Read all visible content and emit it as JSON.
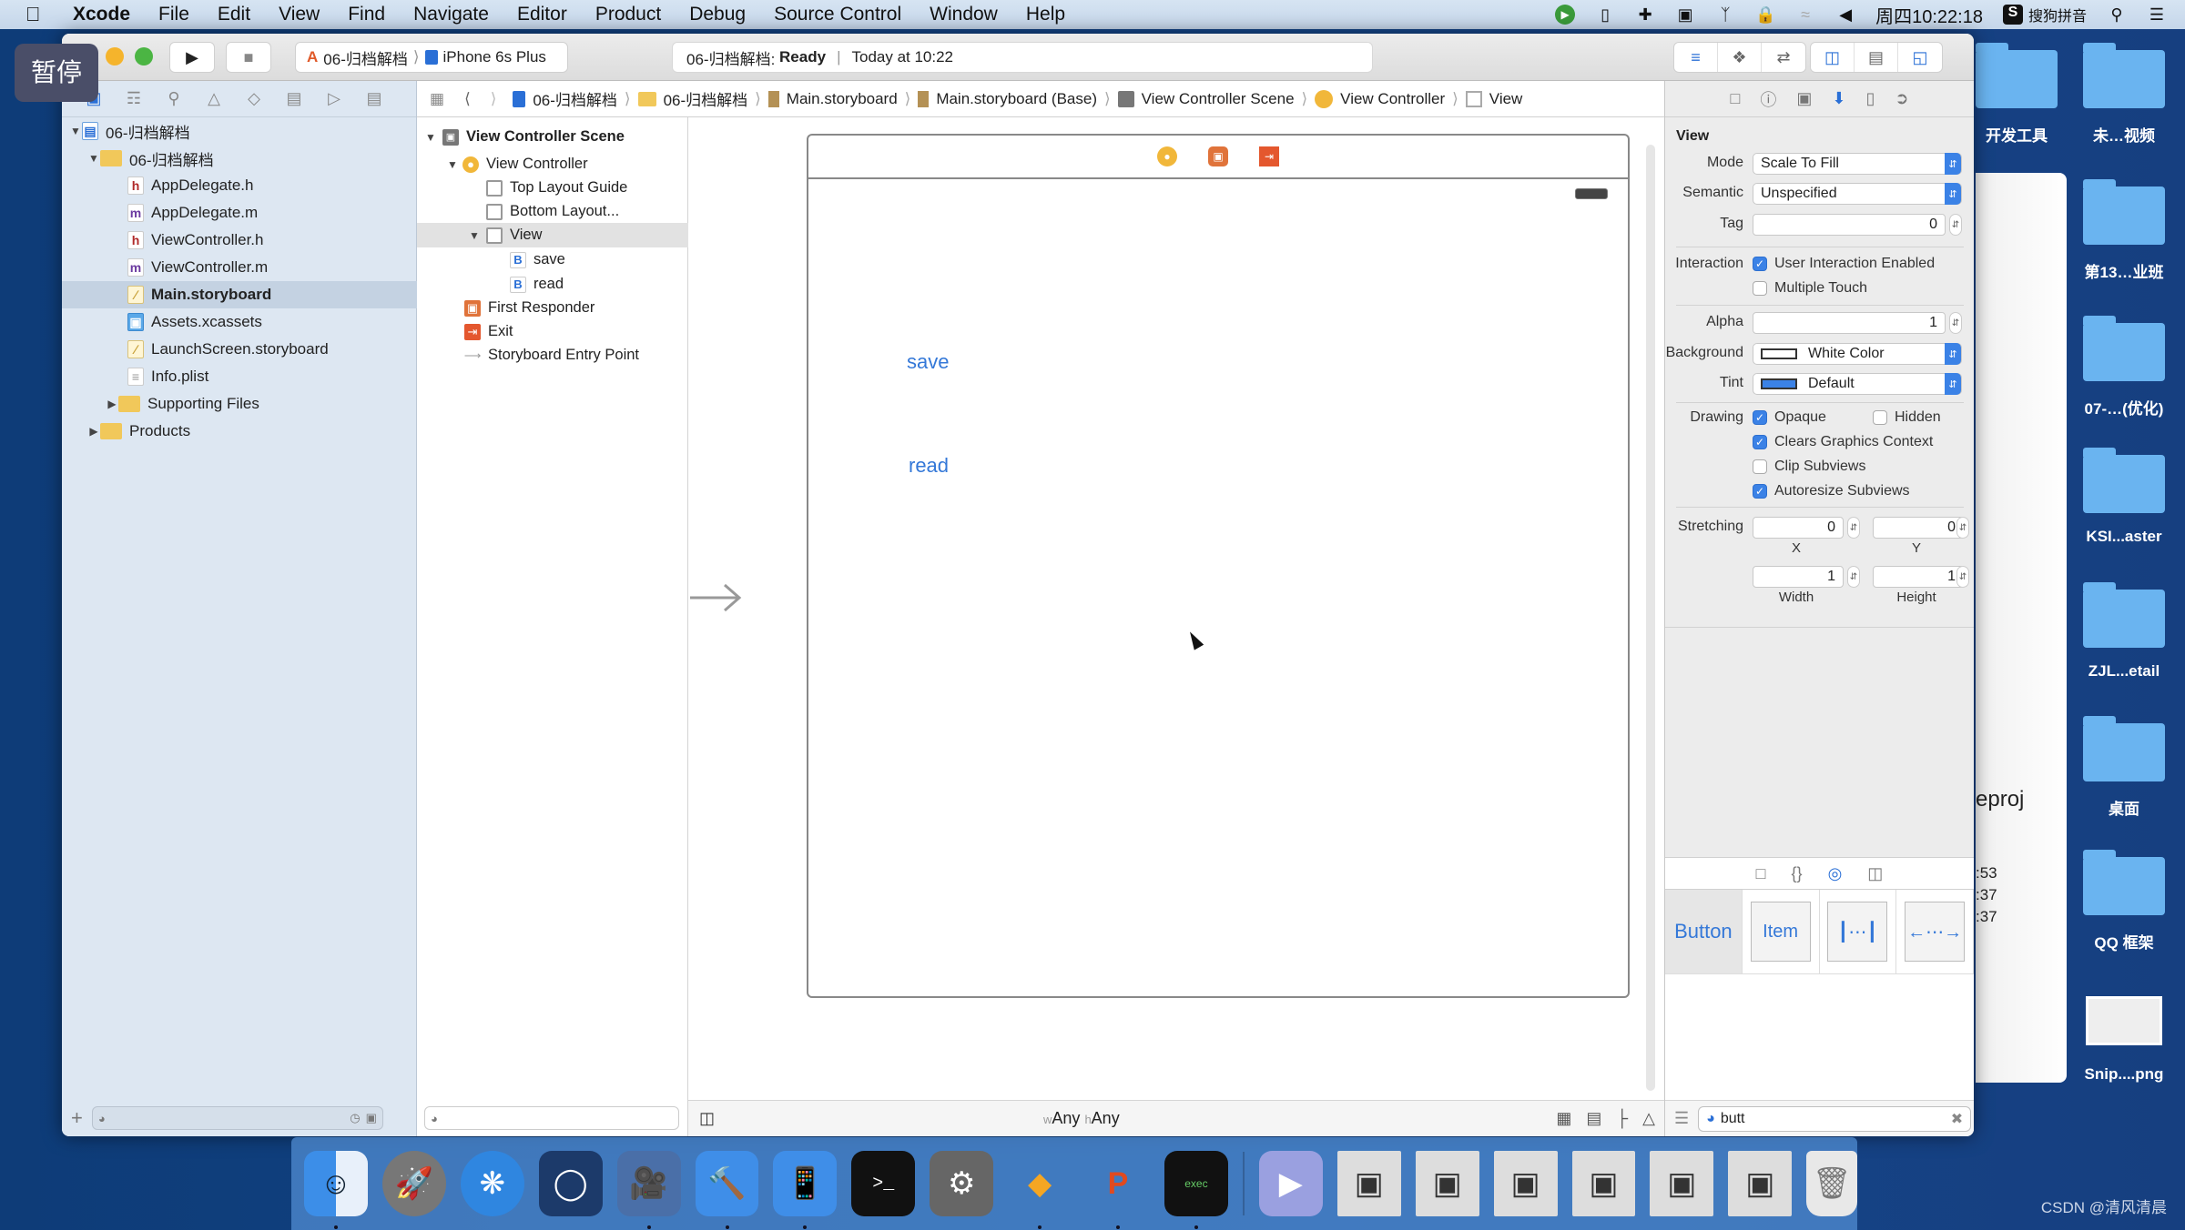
{
  "menubar": {
    "apple_icon": "apple-icon",
    "app": "Xcode",
    "items": [
      "File",
      "Edit",
      "View",
      "Find",
      "Navigate",
      "Editor",
      "Product",
      "Debug",
      "Source Control",
      "Window",
      "Help"
    ],
    "clock": "周四10:22:18",
    "input_method": "搜狗拼音"
  },
  "overlay": {
    "pause_label": "暂停"
  },
  "toolbar": {
    "scheme": "06-归档解档",
    "device": "iPhone 6s Plus",
    "activity_project": "06-归档解档:",
    "activity_status": "Ready",
    "activity_time": "Today at 10:22"
  },
  "navigator": {
    "project": "06-归档解档",
    "group": "06-归档解档",
    "files": [
      {
        "name": "AppDelegate.h",
        "type": "h"
      },
      {
        "name": "AppDelegate.m",
        "type": "m"
      },
      {
        "name": "ViewController.h",
        "type": "h"
      },
      {
        "name": "ViewController.m",
        "type": "m"
      },
      {
        "name": "Main.storyboard",
        "type": "storyboard",
        "selected": true
      },
      {
        "name": "Assets.xcassets",
        "type": "assets"
      },
      {
        "name": "LaunchScreen.storyboard",
        "type": "storyboard"
      },
      {
        "name": "Info.plist",
        "type": "plist"
      }
    ],
    "supporting_files": "Supporting Files",
    "products": "Products"
  },
  "jumpbar": {
    "items": [
      "06-归档解档",
      "06-归档解档",
      "Main.storyboard",
      "Main.storyboard (Base)",
      "View Controller Scene",
      "View Controller",
      "View"
    ]
  },
  "outline": {
    "scene": "View Controller Scene",
    "controller": "View Controller",
    "top_guide": "Top Layout Guide",
    "bottom_guide": "Bottom Layout...",
    "view": "View",
    "buttons": [
      "save",
      "read"
    ],
    "first_responder": "First Responder",
    "exit": "Exit",
    "entry_point": "Storyboard Entry Point"
  },
  "canvas": {
    "buttons": [
      "save",
      "read"
    ],
    "size_class_w_prefix": "w",
    "size_class_w": "Any",
    "size_class_h_prefix": "h",
    "size_class_h": "Any"
  },
  "inspector": {
    "section": "View",
    "mode_label": "Mode",
    "mode": "Scale To Fill",
    "semantic_label": "Semantic",
    "semantic": "Unspecified",
    "tag_label": "Tag",
    "tag": "0",
    "interaction_label": "Interaction",
    "user_interaction": {
      "label": "User Interaction Enabled",
      "checked": true
    },
    "multiple_touch": {
      "label": "Multiple Touch",
      "checked": false
    },
    "alpha_label": "Alpha",
    "alpha": "1",
    "background_label": "Background",
    "background": "White Color",
    "tint_label": "Tint",
    "tint": "Default",
    "drawing_label": "Drawing",
    "opaque": {
      "label": "Opaque",
      "checked": true
    },
    "hidden": {
      "label": "Hidden",
      "checked": false
    },
    "clears": {
      "label": "Clears Graphics Context",
      "checked": true
    },
    "clip": {
      "label": "Clip Subviews",
      "checked": false
    },
    "autoresize": {
      "label": "Autoresize Subviews",
      "checked": true
    },
    "stretching_label": "Stretching",
    "stretch_x": "0",
    "stretch_y": "0",
    "stretch_w": "1",
    "stretch_h": "1",
    "x_label": "X",
    "y_label": "Y",
    "width_label": "Width",
    "height_label": "Height"
  },
  "library": {
    "items": [
      "Button",
      "Item",
      "flexible-space",
      "fixed-space"
    ],
    "search_value": "butt"
  },
  "desktop": {
    "items": [
      "开发工具",
      "未…视频",
      "第13…业班",
      "07-…(优化)",
      "KSI...aster",
      "ZJL...etail",
      "桌面",
      "QQ 框架",
      "Snip....png"
    ],
    "background_window_text": "eproj",
    "background_window_times": [
      ":53",
      ":37",
      ":37"
    ]
  },
  "dock": {
    "apps": [
      "finder",
      "launchpad",
      "safari",
      "mouse-app",
      "video-app",
      "xcode",
      "simulator",
      "terminal",
      "system-preferences",
      "sketch",
      "powerpoint",
      "console",
      "media-player",
      "window-1",
      "window-2",
      "window-3",
      "window-4",
      "window-5",
      "window-6",
      "trash"
    ]
  },
  "watermark": "CSDN @清风清晨",
  "colors": {
    "accent": "#3478d8",
    "tint": "#3b82e6"
  }
}
